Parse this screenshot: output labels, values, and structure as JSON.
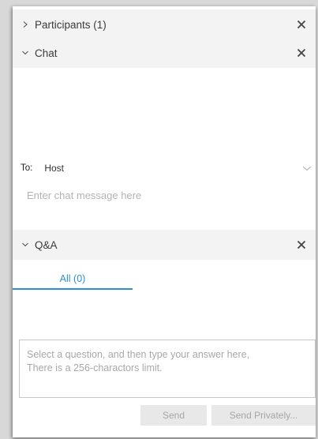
{
  "participants": {
    "title": "Participants (1)"
  },
  "chat": {
    "title": "Chat",
    "to_label": "To:",
    "to_value": "Host",
    "message_placeholder": "Enter chat message here"
  },
  "qa": {
    "title": "Q&A",
    "tabs": [
      {
        "label": "All (0)",
        "selected": true
      }
    ],
    "answer_placeholder": "Select a question, and then type your answer here,\nThere is a 256-charactors limit.",
    "send_label": "Send",
    "send_privately_label": "Send Privately..."
  },
  "icons": {
    "collapsed": "chevron-right-icon",
    "expanded": "chevron-down-icon",
    "close": "close-icon"
  },
  "colors": {
    "accent": "#2b90d0",
    "header_bg": "#f3f3f3",
    "disabled_button_bg": "#e8e8e8",
    "disabled_text": "#a6a6a6"
  }
}
